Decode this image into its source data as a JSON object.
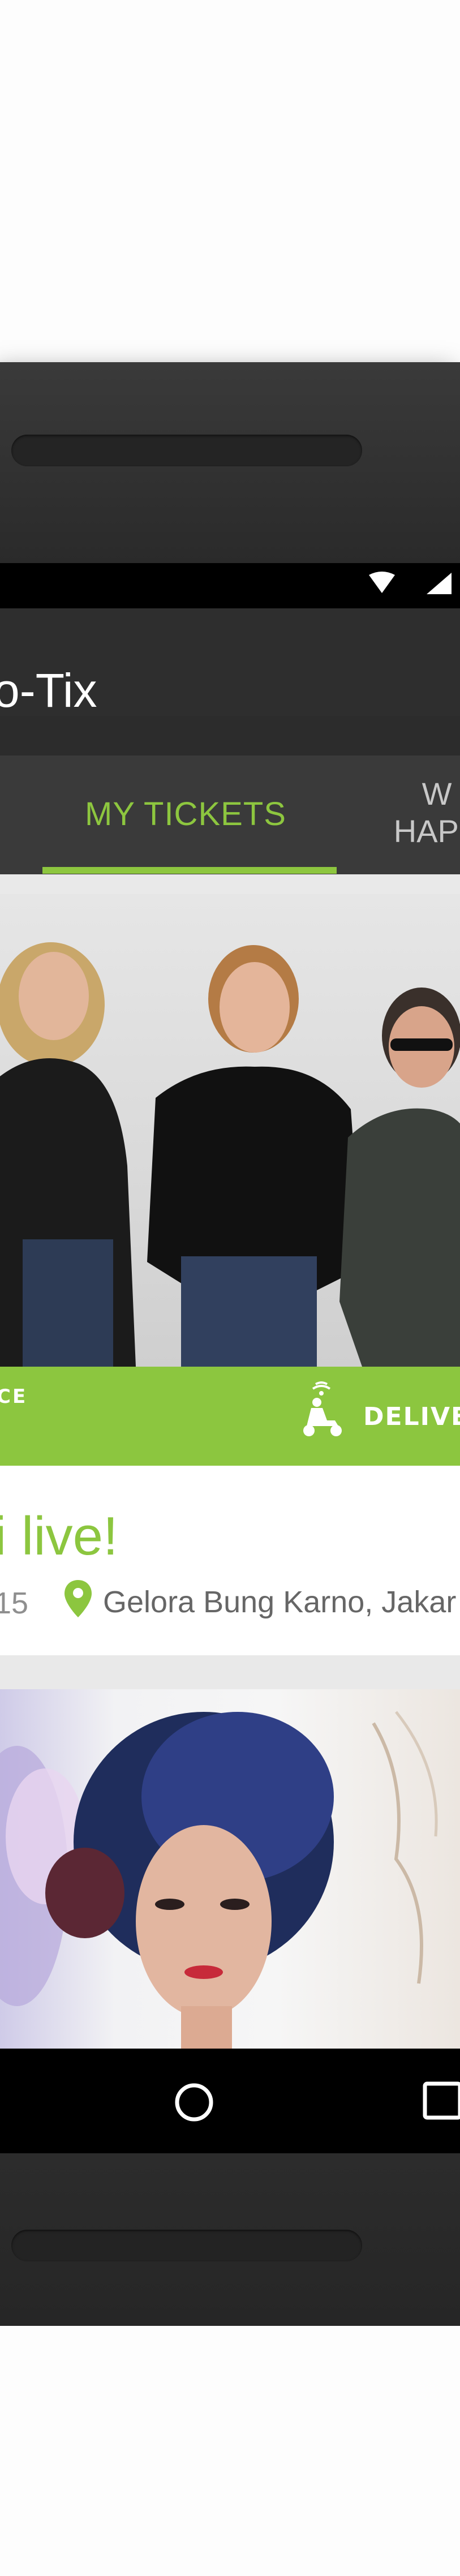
{
  "app": {
    "title": "o-Tix"
  },
  "tabs": [
    {
      "label": "MY TICKETS",
      "selected": true
    },
    {
      "label_line1": "W",
      "label_line2": "HAPP",
      "selected": false
    }
  ],
  "ticket": {
    "service_label": "CE",
    "delivery_label": "DELIVE",
    "event_title": "i live!",
    "event_date": "15",
    "event_venue": "Gelora Bung Karno, Jakar"
  },
  "colors": {
    "accent": "#8cc63f",
    "app_bar": "#2e2e2e",
    "tab_bar": "#3a3a3a",
    "status_bar": "#000000"
  },
  "icons": {
    "status": [
      "wifi-icon",
      "signal-icon"
    ],
    "service": "scooter-delivery-icon",
    "location": "map-pin-icon",
    "nav": [
      "home-icon",
      "recents-icon"
    ]
  }
}
